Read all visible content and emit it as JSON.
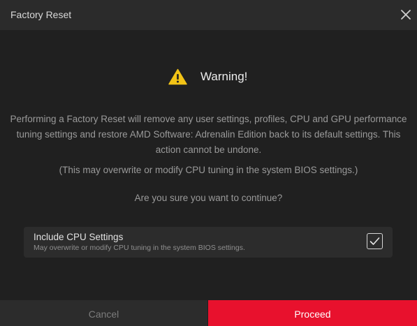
{
  "dialog": {
    "title": "Factory Reset",
    "close_icon": "close-icon"
  },
  "warning": {
    "icon": "warning-triangle-icon",
    "title": "Warning!"
  },
  "message": {
    "body": "Performing a Factory Reset will remove any user settings, profiles, CPU and GPU performance tuning settings and restore AMD Software: Adrenalin Edition back to its default settings. This action cannot be undone.",
    "note": "(This may overwrite or modify CPU tuning in the system BIOS settings.)",
    "question": "Are you sure you want to continue?"
  },
  "option": {
    "label": "Include CPU Settings",
    "description": "May overwrite or modify CPU tuning in the system BIOS settings.",
    "checked": true,
    "check_icon": "checkmark-icon"
  },
  "footer": {
    "cancel_label": "Cancel",
    "proceed_label": "Proceed"
  },
  "colors": {
    "accent": "#e8112d",
    "warning": "#f2c316",
    "background": "#202020",
    "titlebar": "#2b2b2b"
  }
}
